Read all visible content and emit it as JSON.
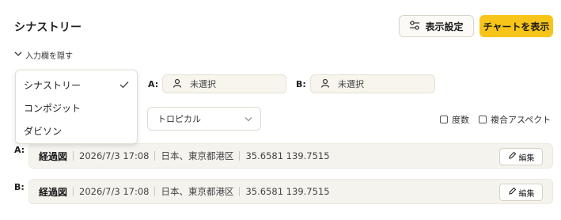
{
  "header": {
    "title": "シナストリー",
    "settings_label": "表示設定",
    "chart_label": "チャートを表示",
    "accent": "#f7c41a"
  },
  "toggle": {
    "label": "入力欄を隠す"
  },
  "inputs": {
    "a_label": "A:",
    "a_value": "未選択",
    "b_label": "B:",
    "b_value": "未選択"
  },
  "dropdown": {
    "items": [
      {
        "label": "シナストリー",
        "selected": true
      },
      {
        "label": "コンポジット",
        "selected": false
      },
      {
        "label": "ダビソン",
        "selected": false
      }
    ]
  },
  "zodiac_select": {
    "value": "トロピカル"
  },
  "options": {
    "degree_label": "度数",
    "composite_aspect_label": "複合アスペクト"
  },
  "records": [
    {
      "label": "A:",
      "title": "経過図",
      "datetime": "2026/7/3 17:08",
      "place": "日本、東京都港区",
      "coords": "35.6581 139.7515",
      "edit_label": "編集"
    },
    {
      "label": "B:",
      "title": "経過図",
      "datetime": "2026/7/3 17:08",
      "place": "日本、東京都港区",
      "coords": "35.6581 139.7515",
      "edit_label": "編集"
    }
  ]
}
